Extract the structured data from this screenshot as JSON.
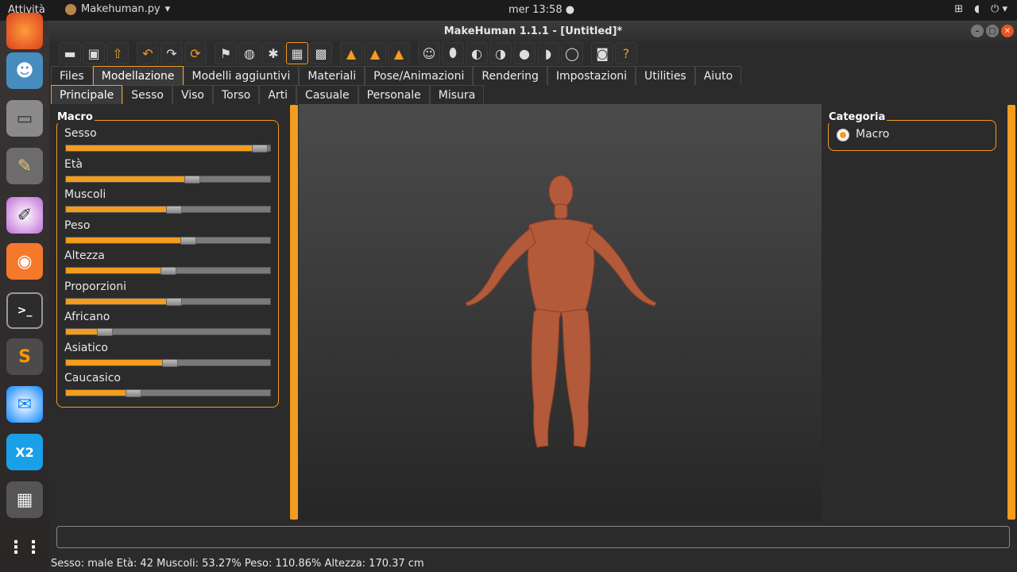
{
  "topbar": {
    "activities": "Attività",
    "app_name": "Makehuman.py",
    "app_arrow": "▾",
    "clock": "mer 13:58 ●",
    "tray": [
      "network-icon",
      "volume-icon",
      "power-icon"
    ]
  },
  "dock": {
    "apps": [
      "firefox",
      "godot",
      "files",
      "gimp",
      "krita",
      "blender",
      "terminal",
      "sublime-text",
      "thunderbird",
      "grafx2",
      "calculator",
      "show-apps"
    ]
  },
  "window": {
    "title": "MakeHuman 1.1.1 - [Untitled]*"
  },
  "tabs_main": [
    "Files",
    "Modellazione",
    "Modelli aggiuntivi",
    "Materiali",
    "Pose/Animazioni",
    "Rendering",
    "Impostazioni",
    "Utilities",
    "Aiuto"
  ],
  "tabs_main_active": "Modellazione",
  "tabs_sub": [
    "Principale",
    "Sesso",
    "Viso",
    "Torso",
    "Arti",
    "Casuale",
    "Personale",
    "Misura"
  ],
  "tabs_sub_active": "Principale",
  "left_panel": {
    "title": "Macro",
    "sliders": [
      {
        "label": "Sesso",
        "value": 0.95
      },
      {
        "label": "Età",
        "value": 0.62
      },
      {
        "label": "Muscoli",
        "value": 0.53
      },
      {
        "label": "Peso",
        "value": 0.6
      },
      {
        "label": "Altezza",
        "value": 0.5
      },
      {
        "label": "Proporzioni",
        "value": 0.53
      },
      {
        "label": "Africano",
        "value": 0.19
      },
      {
        "label": "Asiatico",
        "value": 0.51
      },
      {
        "label": "Caucasico",
        "value": 0.33
      }
    ]
  },
  "right_panel": {
    "title": "Categoria",
    "option": "Macro"
  },
  "status": "Sesso: male Età: 42 Muscoli: 53.27% Peso: 110.86% Altezza: 170.37 cm",
  "colors": {
    "accent": "#f39c1e",
    "skin": "#b35a3a"
  }
}
